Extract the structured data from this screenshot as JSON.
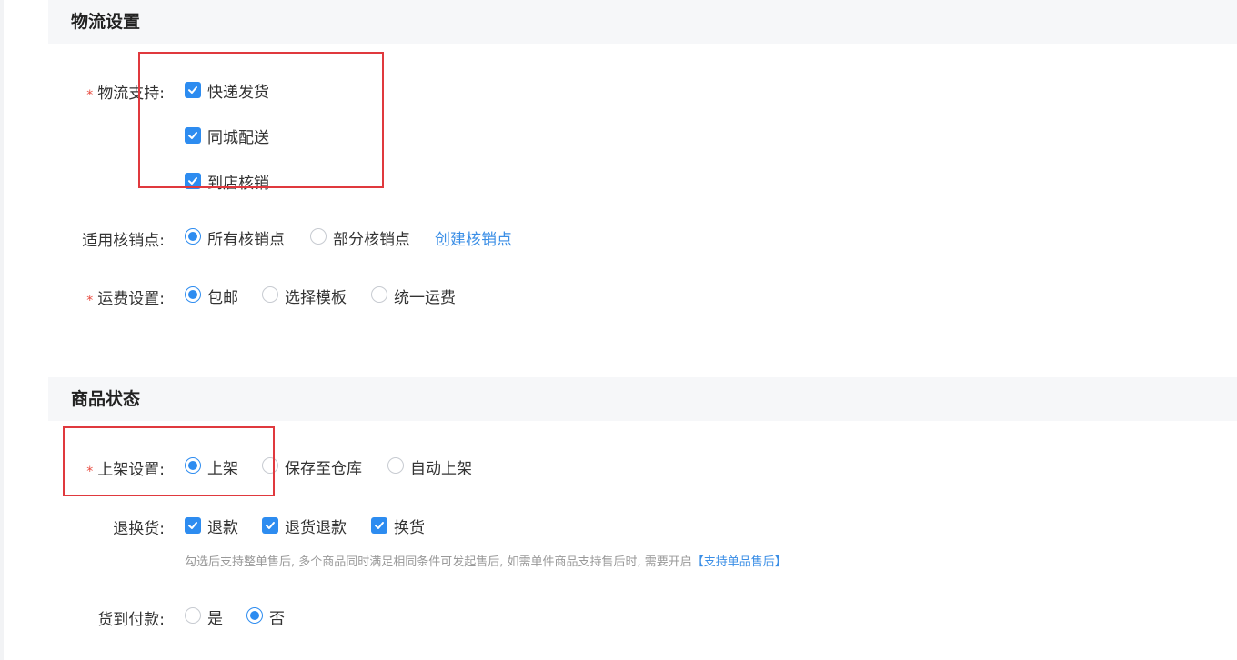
{
  "logistics": {
    "title": "物流设置",
    "support_label": "物流支持:",
    "support_options": [
      {
        "label": "快递发货",
        "checked": true
      },
      {
        "label": "同城配送",
        "checked": true
      },
      {
        "label": "到店核销",
        "checked": true
      }
    ],
    "verify_label": "适用核销点:",
    "verify_options": [
      {
        "label": "所有核销点",
        "selected": true
      },
      {
        "label": "部分核销点",
        "selected": false
      }
    ],
    "create_verify_link": "创建核销点",
    "freight_label": "运费设置:",
    "freight_options": [
      {
        "label": "包邮",
        "selected": true
      },
      {
        "label": "选择模板",
        "selected": false
      },
      {
        "label": "统一运费",
        "selected": false
      }
    ]
  },
  "status": {
    "title": "商品状态",
    "listing_label": "上架设置:",
    "listing_options": [
      {
        "label": "上架",
        "selected": true
      },
      {
        "label": "保存至仓库",
        "selected": false
      },
      {
        "label": "自动上架",
        "selected": false
      }
    ],
    "return_label": "退换货:",
    "return_options": [
      {
        "label": "退款",
        "checked": true
      },
      {
        "label": "退货退款",
        "checked": true
      },
      {
        "label": "换货",
        "checked": true
      }
    ],
    "return_hint": "勾选后支持整单售后, 多个商品同时满足相同条件可发起售后, 如需单件商品支持售后时, 需要开启",
    "return_hint_link": "【支持单品售后】",
    "cod_label": "货到付款:",
    "cod_options": [
      {
        "label": "是",
        "selected": false
      },
      {
        "label": "否",
        "selected": true
      }
    ]
  },
  "required_mark": "*",
  "colors": {
    "accent": "#2d8cf0",
    "link": "#3a8ee6",
    "required": "#e84a3f",
    "highlight_box": "#e0393e",
    "section_bg": "#f6f7f9"
  }
}
